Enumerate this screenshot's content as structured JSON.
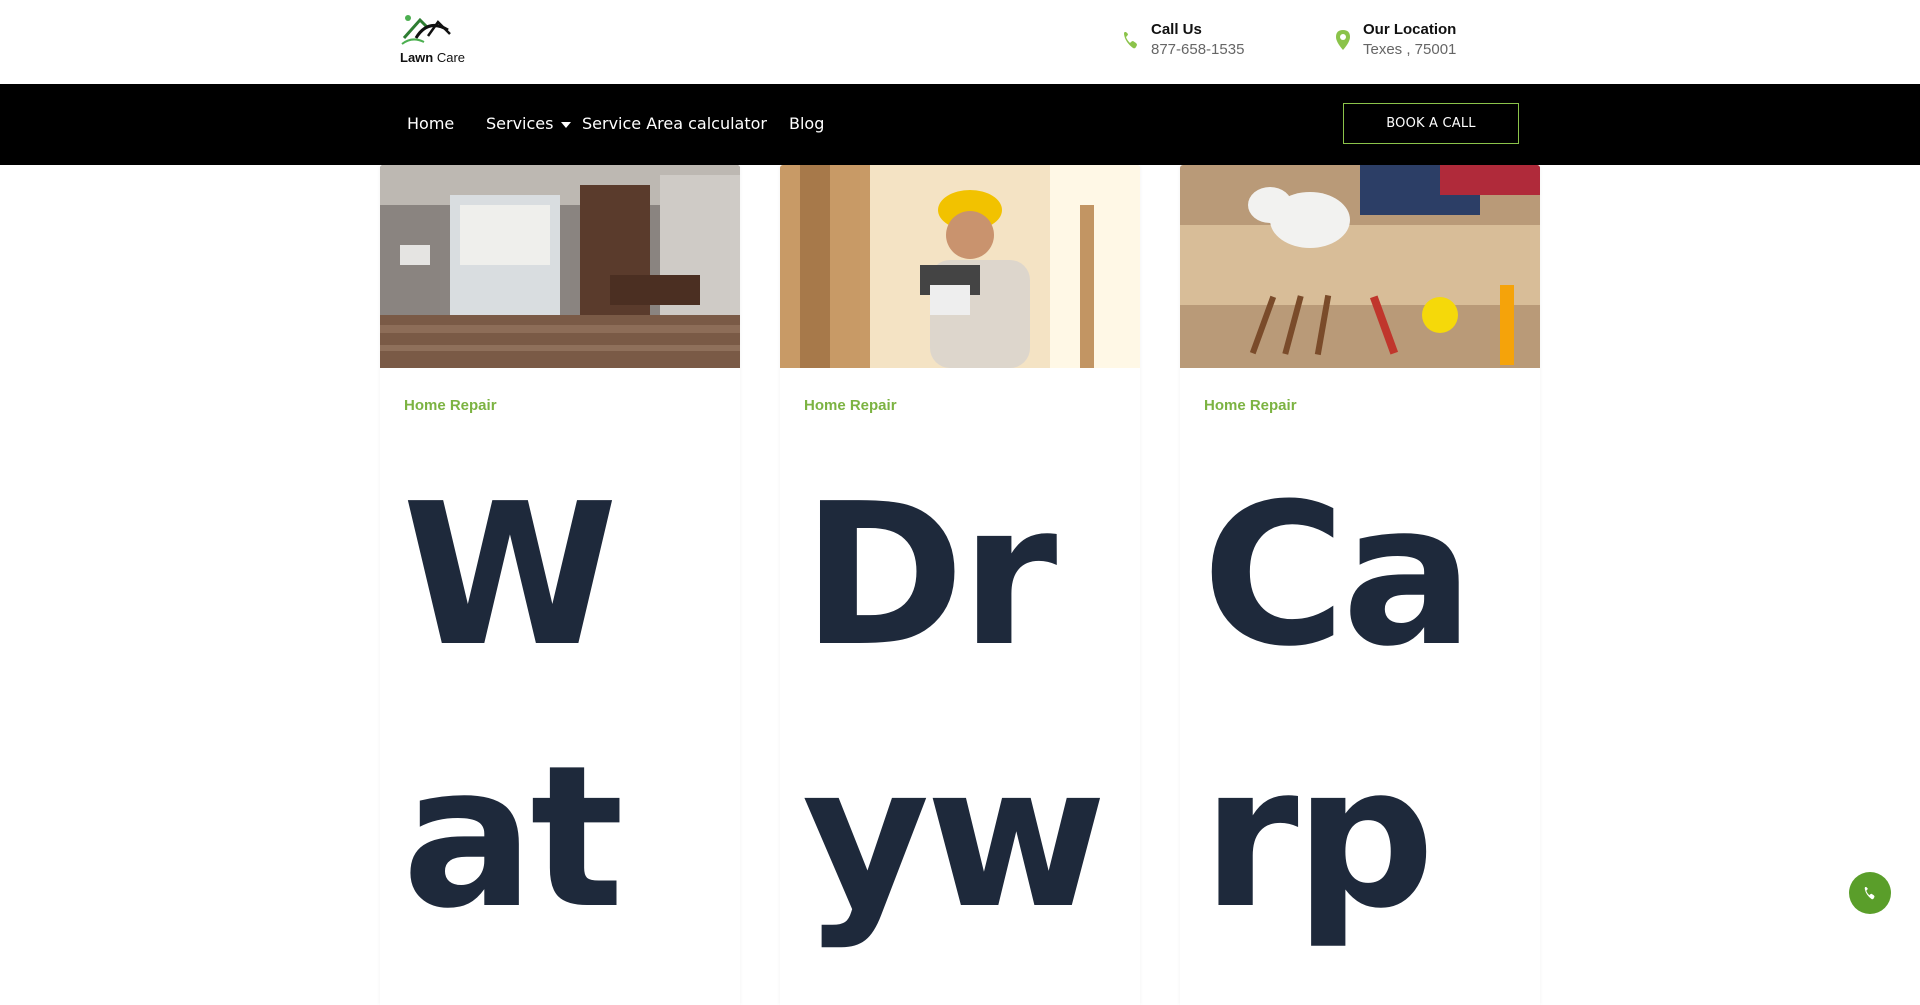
{
  "header": {
    "logo": {
      "brand_bold": "Lawn",
      "brand_light": "Care"
    },
    "call": {
      "label": "Call Us",
      "value": "877-658-1535",
      "icon": "phone-icon"
    },
    "location": {
      "label": "Our Location",
      "value": "Texes , 75001",
      "icon": "location-pin-icon"
    }
  },
  "nav": {
    "items": [
      "Home",
      "Services",
      "Service Area calculator",
      "Blog"
    ],
    "cta": "BOOK A CALL"
  },
  "cards": [
    {
      "category": "Home Repair",
      "title_line1": "W",
      "title_line2": "at",
      "image": "flooded-bathroom"
    },
    {
      "category": "Home Repair",
      "title_line1": "Dr",
      "title_line2": "yw",
      "image": "worker-with-drill"
    },
    {
      "category": "Home Repair",
      "title_line1": "Ca",
      "title_line2": "rp",
      "image": "carpentry-tools"
    }
  ],
  "colors": {
    "accent": "#7cb342",
    "nav_bg": "#000000",
    "title": "#1e293b",
    "fab": "#5a9e2a"
  },
  "fab": {
    "icon": "phone-icon"
  }
}
